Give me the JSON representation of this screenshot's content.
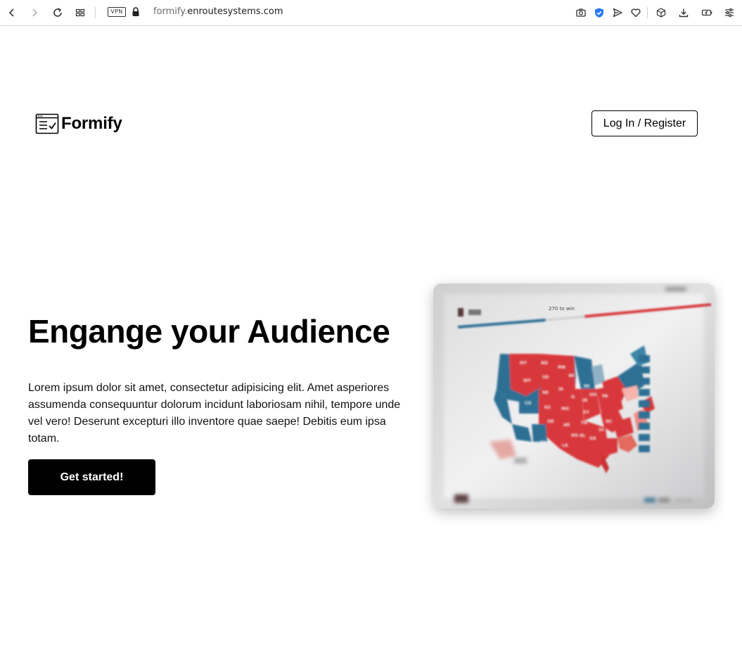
{
  "browser": {
    "vpn_label": "VPN",
    "url_subdomain": "formify.",
    "url_domain": "enroutesystems.com"
  },
  "header": {
    "brand": "Formify",
    "login_label": "Log In / Register"
  },
  "hero": {
    "title": "Engange your Audience",
    "body": "Lorem ipsum dolor sit amet, consectetur adipisicing elit. Amet asperiores assumenda consequuntur dolorum incidunt laboriosam nihil, tempore unde vel vero! Deserunt excepturi illo inventore quae saepe! Debitis eum ipsa totam.",
    "cta_label": "Get started!",
    "image_caption": "270 to win"
  },
  "colors": {
    "republican": "#d8383a",
    "democrat": "#2f6f94"
  }
}
